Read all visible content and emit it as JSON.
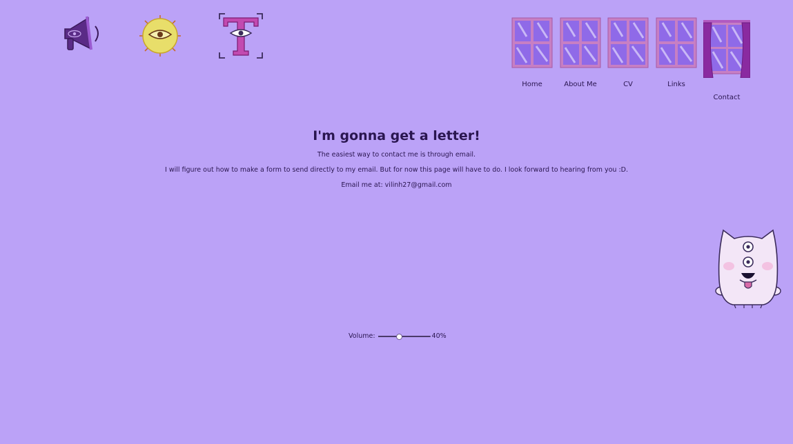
{
  "colors": {
    "background": "#bba2f7",
    "text": "#2a1650",
    "window_frame": "#c77fc4",
    "window_glass": "#8f6ae8",
    "curtain": "#8a2aa0"
  },
  "toolbar": {
    "icons": [
      "megaphone-icon",
      "sun-eye-icon",
      "font-t-icon"
    ]
  },
  "nav": {
    "items": [
      {
        "label": "Home",
        "icon": "window-icon"
      },
      {
        "label": "About Me",
        "icon": "window-icon"
      },
      {
        "label": "CV",
        "icon": "window-icon"
      },
      {
        "label": "Links",
        "icon": "window-icon"
      },
      {
        "label": "Contact",
        "icon": "curtain-window-icon"
      }
    ]
  },
  "main": {
    "title": "I'm gonna get a letter!",
    "paragraphs": [
      "The easiest way to contact me is through email.",
      "I will figure out how to make a form to send directly to my email. But for now this page will have to do. I look forward to hearing from you :D.",
      "Email me at: vilinh27@gmail.com"
    ]
  },
  "volume": {
    "label": "Volume:",
    "value": 0.4,
    "value_text": "40%"
  }
}
